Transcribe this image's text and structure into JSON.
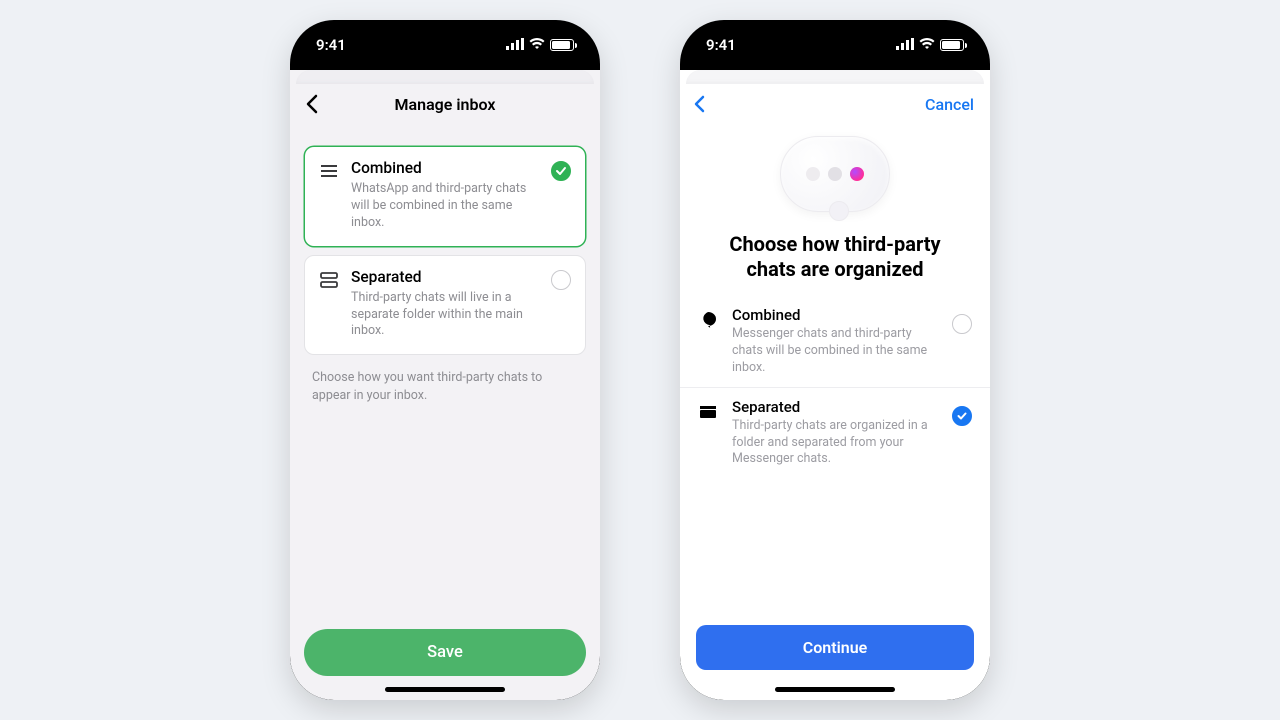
{
  "status": {
    "time": "9:41"
  },
  "left": {
    "header_title": "Manage inbox",
    "options": [
      {
        "title": "Combined",
        "desc": "WhatsApp and third-party chats will be combined in the same inbox."
      },
      {
        "title": "Separated",
        "desc": "Third-party chats will live in a separate folder within the main inbox."
      }
    ],
    "hint": "Choose how you want third-party chats to appear in your inbox.",
    "save_label": "Save"
  },
  "right": {
    "cancel_label": "Cancel",
    "title": "Choose how third-party chats are organized",
    "options": [
      {
        "title": "Combined",
        "desc": "Messenger chats and third-party chats will be combined in the same inbox."
      },
      {
        "title": "Separated",
        "desc": "Third-party chats are organized in a folder and separated from your Messenger chats."
      }
    ],
    "continue_label": "Continue"
  }
}
